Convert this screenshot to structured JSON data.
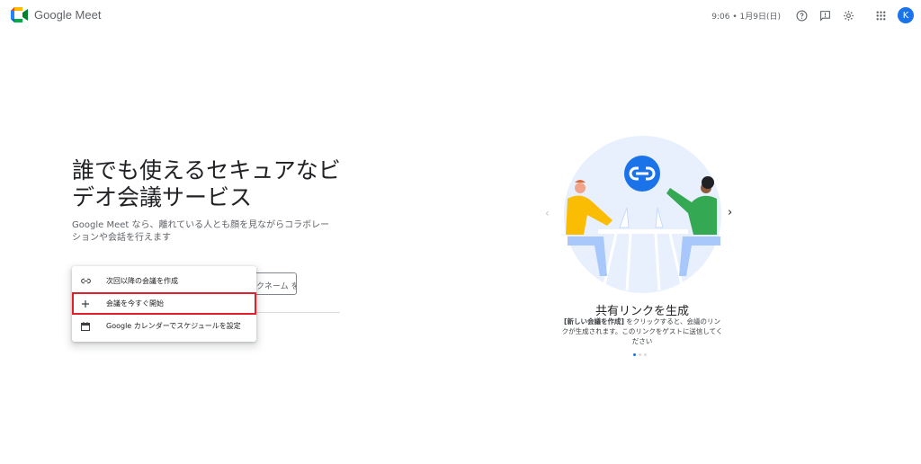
{
  "header": {
    "app_name": "Google Meet",
    "datetime": "9:06 • 1月9日(日)",
    "avatar_letter": "K"
  },
  "hero": {
    "title": "誰でも使えるセキュアなビデオ会議サービス",
    "description": "Google Meet なら、離れている人とも顔を見ながらコラボレーションや会話を行えます",
    "code_input_placeholder": "クネーム を"
  },
  "menu": {
    "items": [
      {
        "label": "次回以降の会議を作成",
        "icon": "link-icon"
      },
      {
        "label": "会議を今すぐ開始",
        "icon": "plus-icon"
      },
      {
        "label": "Google カレンダーでスケジュールを設定",
        "icon": "calendar-icon"
      }
    ]
  },
  "carousel": {
    "title": "共有リンクを生成",
    "desc_bold": "[新しい会議を作成]",
    "desc_rest": " をクリックすると、会議のリンクが生成されます。このリンクをゲストに送信してください",
    "active_slide": 1,
    "slide_count": 3
  },
  "colors": {
    "accent": "#1a73e8",
    "highlight_border": "#e0202a"
  }
}
